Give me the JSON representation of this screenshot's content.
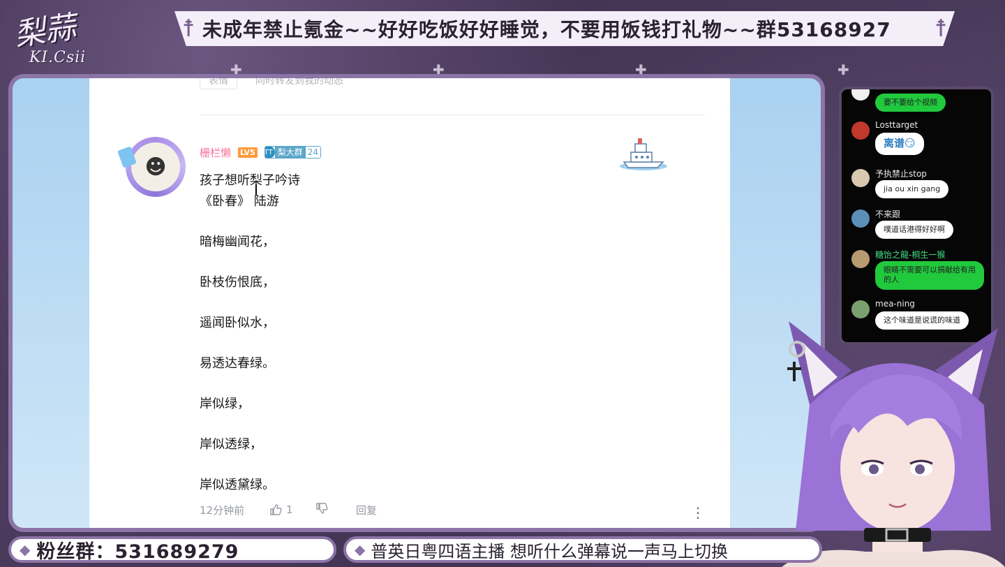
{
  "overlay": {
    "top_banner_text": "未成年禁止氪金~~好好吃饭好好睡觉，不要用饭钱打礼物~~群53168927",
    "logo_main": "梨蒜",
    "logo_sub": "KI.Csii",
    "fan_group_text": "粉丝群：531689279",
    "topic_text": "普英日粤四语主播 想听什么弹幕说一声马上切换"
  },
  "comment_page": {
    "prev_actions": [
      "表情",
      "同时转发到我的动态"
    ],
    "comment": {
      "username": "栅栏懒",
      "level_badge": "LV5",
      "medal_icon_text": "TT",
      "medal_name": "梨大群",
      "medal_level": "24",
      "lines": [
        "孩子想听梨子吟诗",
        "《卧春》 陆游",
        "暗梅幽闻花，",
        "卧枝伤恨底，",
        "遥闻卧似水，",
        "易透达春绿。",
        "岸似绿，",
        "岸似透绿，",
        "岸似透黛绿。"
      ],
      "time": "12分钟前",
      "like_count": "1",
      "reply_label": "回复"
    }
  },
  "chat": {
    "messages": [
      {
        "name": "",
        "text": "要不要给个视频",
        "style": "green",
        "avatar_color": "#f0f0f0"
      },
      {
        "name": "Losttarget",
        "text": "离谱😏",
        "style": "white",
        "avatar_color": "#c0392b"
      },
      {
        "name": "予执禁止stop",
        "text": "jia ou xin gang",
        "style": "white",
        "avatar_color": "#d8c8b0"
      },
      {
        "name": "不来跟",
        "text": "噗道话港得好好啊",
        "style": "white",
        "avatar_color": "#5a8fb8"
      },
      {
        "name": "糖饴之龍-桐生一猴",
        "text": "眼睛不需要可以捐献给有用的人",
        "style": "green",
        "avatar_color": "#b89a70"
      },
      {
        "name": "mea-ning",
        "text": "这个味道是说谎的味道",
        "style": "white",
        "avatar_color": "#7aa070"
      }
    ]
  },
  "colors": {
    "frame_purple": "#8b74a6",
    "username_pink": "#fb7299",
    "chat_green": "#21c93d"
  }
}
